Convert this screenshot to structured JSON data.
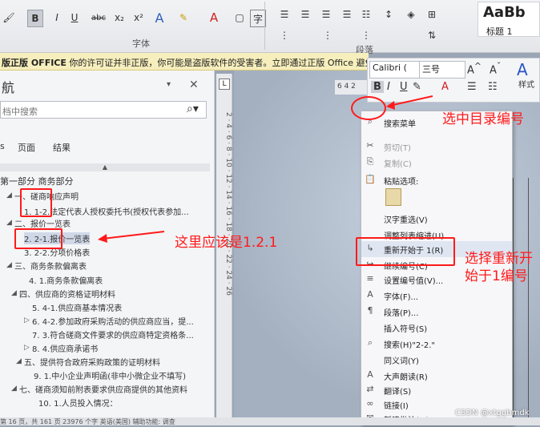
{
  "ribbon": {
    "bold": "B",
    "italic": "I",
    "underline": "U",
    "strikethrough": "abc",
    "subscript": "x₂",
    "superscript": "x²",
    "font_group": "字体",
    "paragraph_group": "段落",
    "style_preview": "AaBb",
    "style_name": "标题 1"
  },
  "notice": {
    "prefix": "版正版 OFFICE",
    "message": "你的许可证并非正版，你可能是盗版软件的受害者。立即通过正版 Office",
    "suffix": "避免"
  },
  "nav": {
    "title": "航",
    "search_placeholder": "档中搜索",
    "tabs": [
      "页面",
      "结果"
    ],
    "items": [
      {
        "text": "第一部分 商务部分"
      },
      {
        "text": "一、磋商响应声明"
      },
      {
        "text": "1. 1-2.法定代表人授权委托书(授权代表参加..."
      },
      {
        "text": "二、报价一览表"
      },
      {
        "text": "2. 2-1.报价一览表"
      },
      {
        "text": "3. 2-2.分项价格表"
      },
      {
        "text": "三、商务条款偏离表"
      },
      {
        "text": "4. 1.商务条款偏离表"
      },
      {
        "text": "四、供应商的资格证明材料"
      },
      {
        "text": "5. 4-1.供应商基本情况表"
      },
      {
        "text": "6. 4-2.参加政府采购活动的供应商应当，提..."
      },
      {
        "text": "7. 3.符合磋商文件要求的供应商特定资格条..."
      },
      {
        "text": "8. 4.供应商承诺书"
      },
      {
        "text": "五、提供符合政府采购政策的证明材料"
      },
      {
        "text": "9. 1.中小企业声明函(非中小微企业不填写)"
      },
      {
        "text": "七、磋商须知前附表要求供应商提供的其他资料"
      },
      {
        "text": "10. 1.人员投入情况："
      }
    ]
  },
  "ruler_digits": "2 · 4 · 6 · 8 · 10 · 12 · 14 · 16 · 18 · 20 · 22 · 24 · 26",
  "mini_toolbar": {
    "font": "Calibri (",
    "size": "三号",
    "tab_numbers": "6 4 2",
    "style_label": "样式"
  },
  "context_menu": {
    "search": "搜索菜单",
    "items": [
      {
        "icon": "scissors-icon",
        "label": "剪切(T)",
        "disabled": true
      },
      {
        "icon": "copy-icon",
        "label": "复制(C)",
        "disabled": true
      },
      {
        "icon": "paste-icon",
        "label": "粘贴选项:",
        "disabled": false
      },
      {
        "icon": "",
        "label": "汉字重选(V)",
        "disabled": false
      },
      {
        "icon": "",
        "label": "调整列表缩进(U)...",
        "disabled": false
      },
      {
        "icon": "restart-icon",
        "label": "重新开始于 1(R)",
        "disabled": false
      },
      {
        "icon": "continue-icon",
        "label": "继续编号(C)",
        "disabled": false
      },
      {
        "icon": "numbering-value-icon",
        "label": "设置编号值(V)...",
        "disabled": false
      },
      {
        "icon": "font-icon",
        "label": "字体(F)...",
        "disabled": false
      },
      {
        "icon": "paragraph-icon",
        "label": "段落(P)...",
        "disabled": false
      },
      {
        "icon": "",
        "label": "插入符号(S)",
        "disabled": false
      },
      {
        "icon": "search-icon",
        "label": "搜索(H)\"2-2.\"",
        "disabled": false
      },
      {
        "icon": "",
        "label": "同义词(Y)",
        "disabled": false
      },
      {
        "icon": "read-aloud-icon",
        "label": "大声朗读(R)",
        "disabled": false
      },
      {
        "icon": "translate-icon",
        "label": "翻译(S)",
        "disabled": false
      },
      {
        "icon": "link-icon",
        "label": "链接(I)",
        "disabled": false
      },
      {
        "icon": "comment-icon",
        "label": "新建批注(M)",
        "disabled": false
      }
    ]
  },
  "annotations": {
    "select_toc": "选中目录编号",
    "should_be": "这里应该是1.2.1",
    "select_restart": "选择重新开始于1编号"
  },
  "status_bar": "第 16 页，共 161 页  23976 个字  英语(美国)  辅助功能: 调查",
  "watermark": "CSDN @xtggbmdk",
  "colors": {
    "annotation": "#ff1a1a",
    "notice_bg": "#f6eebc"
  }
}
